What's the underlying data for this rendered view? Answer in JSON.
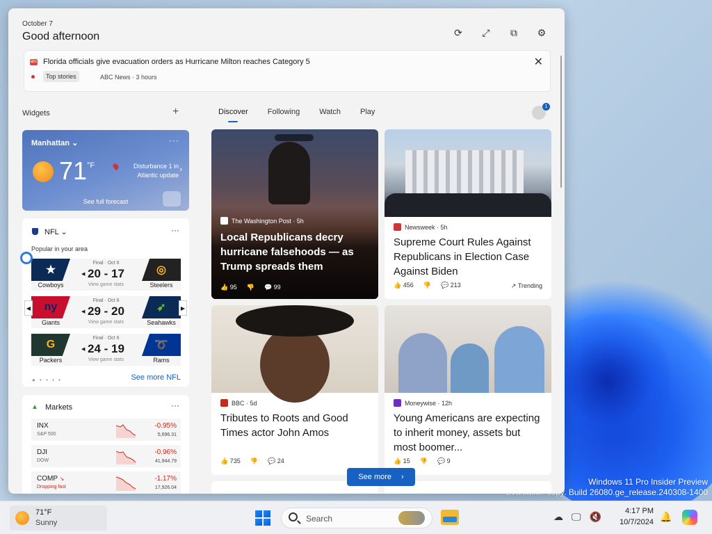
{
  "desktop": {
    "watermark_line1": "Windows 11 Pro Insider Preview",
    "watermark_line2": "Evaluation copy. Build 26080.ge_release.240308-1400"
  },
  "panel": {
    "date": "October 7",
    "greeting": "Good afternoon",
    "alert": {
      "icon_text": "abc",
      "headline": "Florida officials give evacuation orders as Hurricane Milton reaches Category 5",
      "badge": "Top stories",
      "meta": "ABC News · 3 hours"
    },
    "widgets_label": "Widgets",
    "weather": {
      "location": "Manhattan",
      "temp": "71",
      "unit": "°F",
      "alert_text": "Disturbance 1 in Atlantic update",
      "forecast_link": "See full forecast",
      "more": "···"
    },
    "nfl": {
      "title": "NFL",
      "subtitle": "Popular in your area",
      "more": "···",
      "see_more": "See more NFL",
      "games": [
        {
          "status": "Final · Oct 6",
          "score": "20 - 17",
          "link": "View game stats",
          "home": "Cowboys",
          "away": "Steelers"
        },
        {
          "status": "Final · Oct 6",
          "score": "29 - 20",
          "link": "View game stats",
          "home": "Giants",
          "away": "Seahawks"
        },
        {
          "status": "Final · Oct 6",
          "score": "24 - 19",
          "link": "View game stats",
          "home": "Packers",
          "away": "Rams"
        }
      ]
    },
    "markets": {
      "title": "Markets",
      "more": "···",
      "stocks": [
        {
          "symbol": "INX",
          "name": "S&P 500",
          "change": "-0.95%",
          "price": "5,696.31"
        },
        {
          "symbol": "DJI",
          "name": "DOW",
          "change": "-0.96%",
          "price": "41,944.79"
        },
        {
          "symbol": "COMP",
          "name": "Dropping fast",
          "change": "-1.17%",
          "price": "17,926.04"
        }
      ]
    },
    "tabs": [
      "Discover",
      "Following",
      "Watch",
      "Play"
    ],
    "avatar_badge": "1",
    "news": [
      {
        "source": "The Washington Post · 5h",
        "headline": "Local Republicans decry hurricane falsehoods — as Trump spreads them",
        "likes": "95",
        "comments": "99"
      },
      {
        "source": "Newsweek · 5h",
        "headline": "Supreme Court Rules Against Republicans in Election Case Against Biden",
        "likes": "456",
        "comments": "213",
        "trend": "Trending"
      },
      {
        "source": "BBC · 5d",
        "headline": "Tributes to Roots and Good Times actor John Amos",
        "likes": "735",
        "comments": "24"
      },
      {
        "source": "Moneywise · 12h",
        "headline": "Young Americans are expecting to inherit money, assets but most boomer...",
        "likes": "15",
        "comments": "9"
      }
    ],
    "see_more": "See more"
  },
  "taskbar": {
    "weather_temp": "71°F",
    "weather_cond": "Sunny",
    "search_placeholder": "Search",
    "time": "4:17 PM",
    "date": "10/7/2024"
  }
}
